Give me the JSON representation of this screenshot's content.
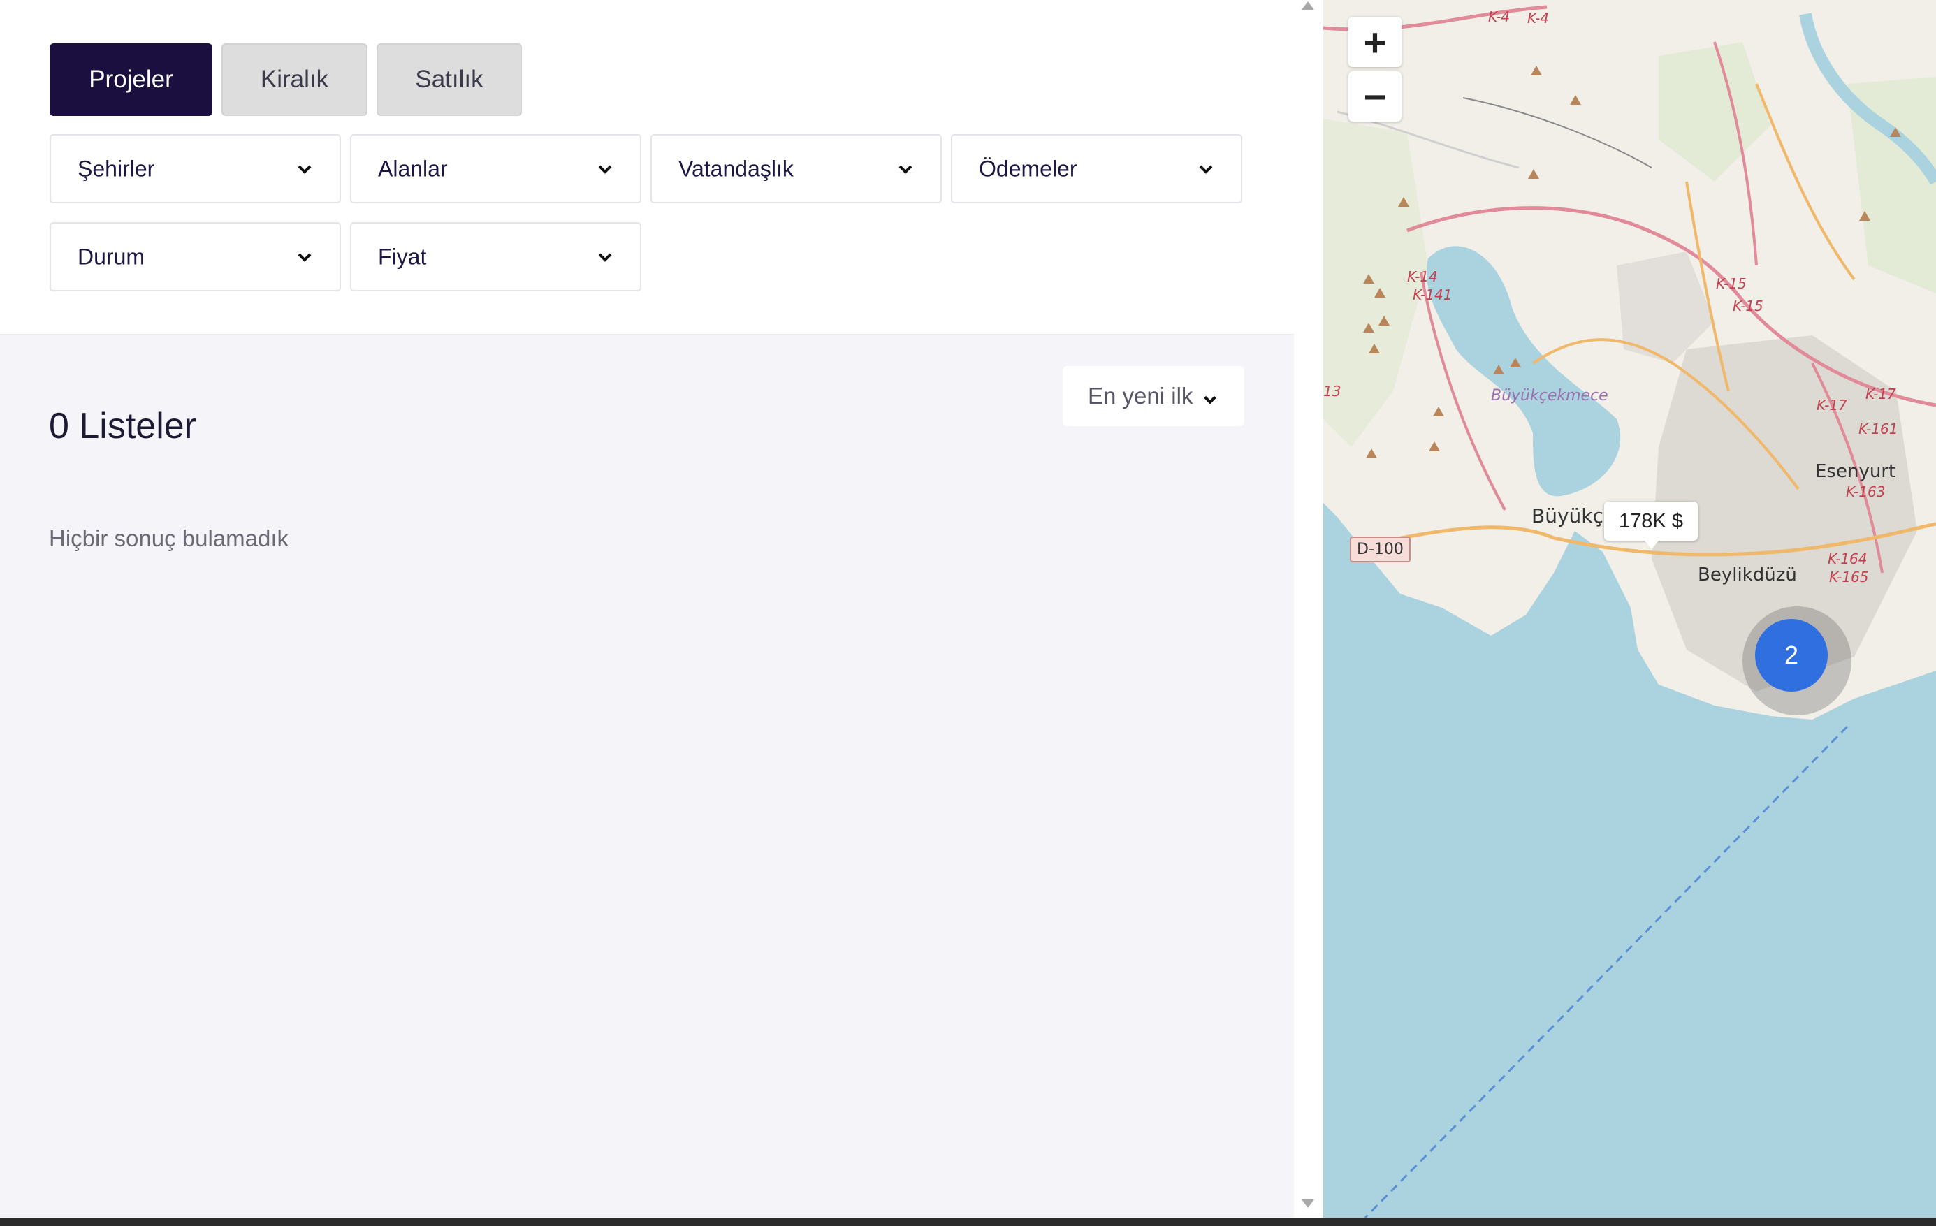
{
  "tabs": [
    {
      "label": "Projeler",
      "active": true
    },
    {
      "label": "Kiralık",
      "active": false
    },
    {
      "label": "Satılık",
      "active": false
    }
  ],
  "filters": {
    "cities": "Şehirler",
    "areas": "Alanlar",
    "citizenship": "Vatandaşlık",
    "payments": "Ödemeler",
    "status": "Durum",
    "price": "Fiyat"
  },
  "sort": {
    "label": "En yeni ilk"
  },
  "results": {
    "count_label": "0 Listeler",
    "empty_message": "Hiçbir sonuç bulamadık"
  },
  "map": {
    "zoom_in": "+",
    "zoom_out": "−",
    "price_marker": "178K $",
    "cluster_count": "2",
    "labels": {
      "esenyurt": "Esenyurt",
      "beylikduzu": "Beylikdüzü",
      "buyukcekmece_town": "Büyükçe",
      "buyukcekmece_lake": "Büyükçekmece",
      "d100": "D-100",
      "k4a": "K-4",
      "k4b": "K-4",
      "k14": "K-14",
      "k141": "K-141",
      "k15a": "K-15",
      "k15b": "K-15",
      "k17a": "K-17",
      "k17b": "K-17",
      "k161": "K-161",
      "k163": "K-163",
      "k164": "K-164",
      "k165": "K-165",
      "k13": "13"
    },
    "colors": {
      "water": "#aad3df",
      "land": "#f2efe9",
      "motorway": "#e08a9a",
      "primary": "#f5c783"
    }
  },
  "colors": {
    "accent": "#1b0f3f",
    "cluster": "#2f6fe0"
  }
}
